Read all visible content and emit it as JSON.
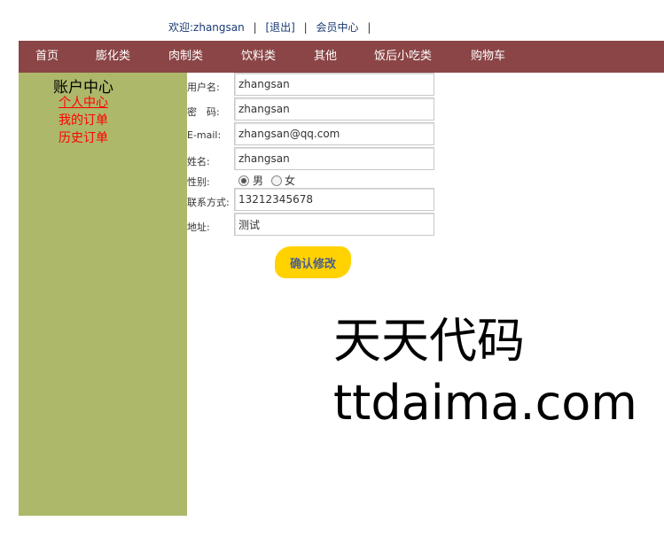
{
  "topbar": {
    "welcome": "欢迎:zhangsan",
    "logout": "[退出]",
    "member_center": "会员中心",
    "separator": "|"
  },
  "nav": {
    "items": [
      {
        "label": "首页"
      },
      {
        "label": "膨化类"
      },
      {
        "label": "肉制类"
      },
      {
        "label": "饮料类"
      },
      {
        "label": "其他"
      },
      {
        "label": "饭后小吃类"
      },
      {
        "label": "购物车"
      }
    ],
    "bg_color": "#8b4546"
  },
  "sidebar": {
    "title": "账户中心",
    "links": [
      {
        "label": "个人中心",
        "active": true
      },
      {
        "label": "我的订单",
        "active": false
      },
      {
        "label": "历史订单",
        "active": false
      }
    ],
    "bg_color": "#aeb86a",
    "link_color": "#ff0000"
  },
  "form": {
    "username": {
      "label": "用户名:",
      "value": "zhangsan"
    },
    "password": {
      "label": "密　码:",
      "value": "zhangsan"
    },
    "email": {
      "label": "E-mail:",
      "value": "zhangsan@qq.com"
    },
    "name": {
      "label": "姓名:",
      "value": "zhangsan"
    },
    "gender": {
      "label": "性别:",
      "options": [
        "男",
        "女"
      ],
      "selected": "男"
    },
    "phone": {
      "label": "联系方式:",
      "value": "13212345678"
    },
    "address": {
      "label": "地址:",
      "value": "测试"
    },
    "submit_label": "确认修改",
    "submit_color": "#ffd200"
  },
  "watermark": {
    "line1": "天天代码",
    "line2": "ttdaima.com"
  }
}
